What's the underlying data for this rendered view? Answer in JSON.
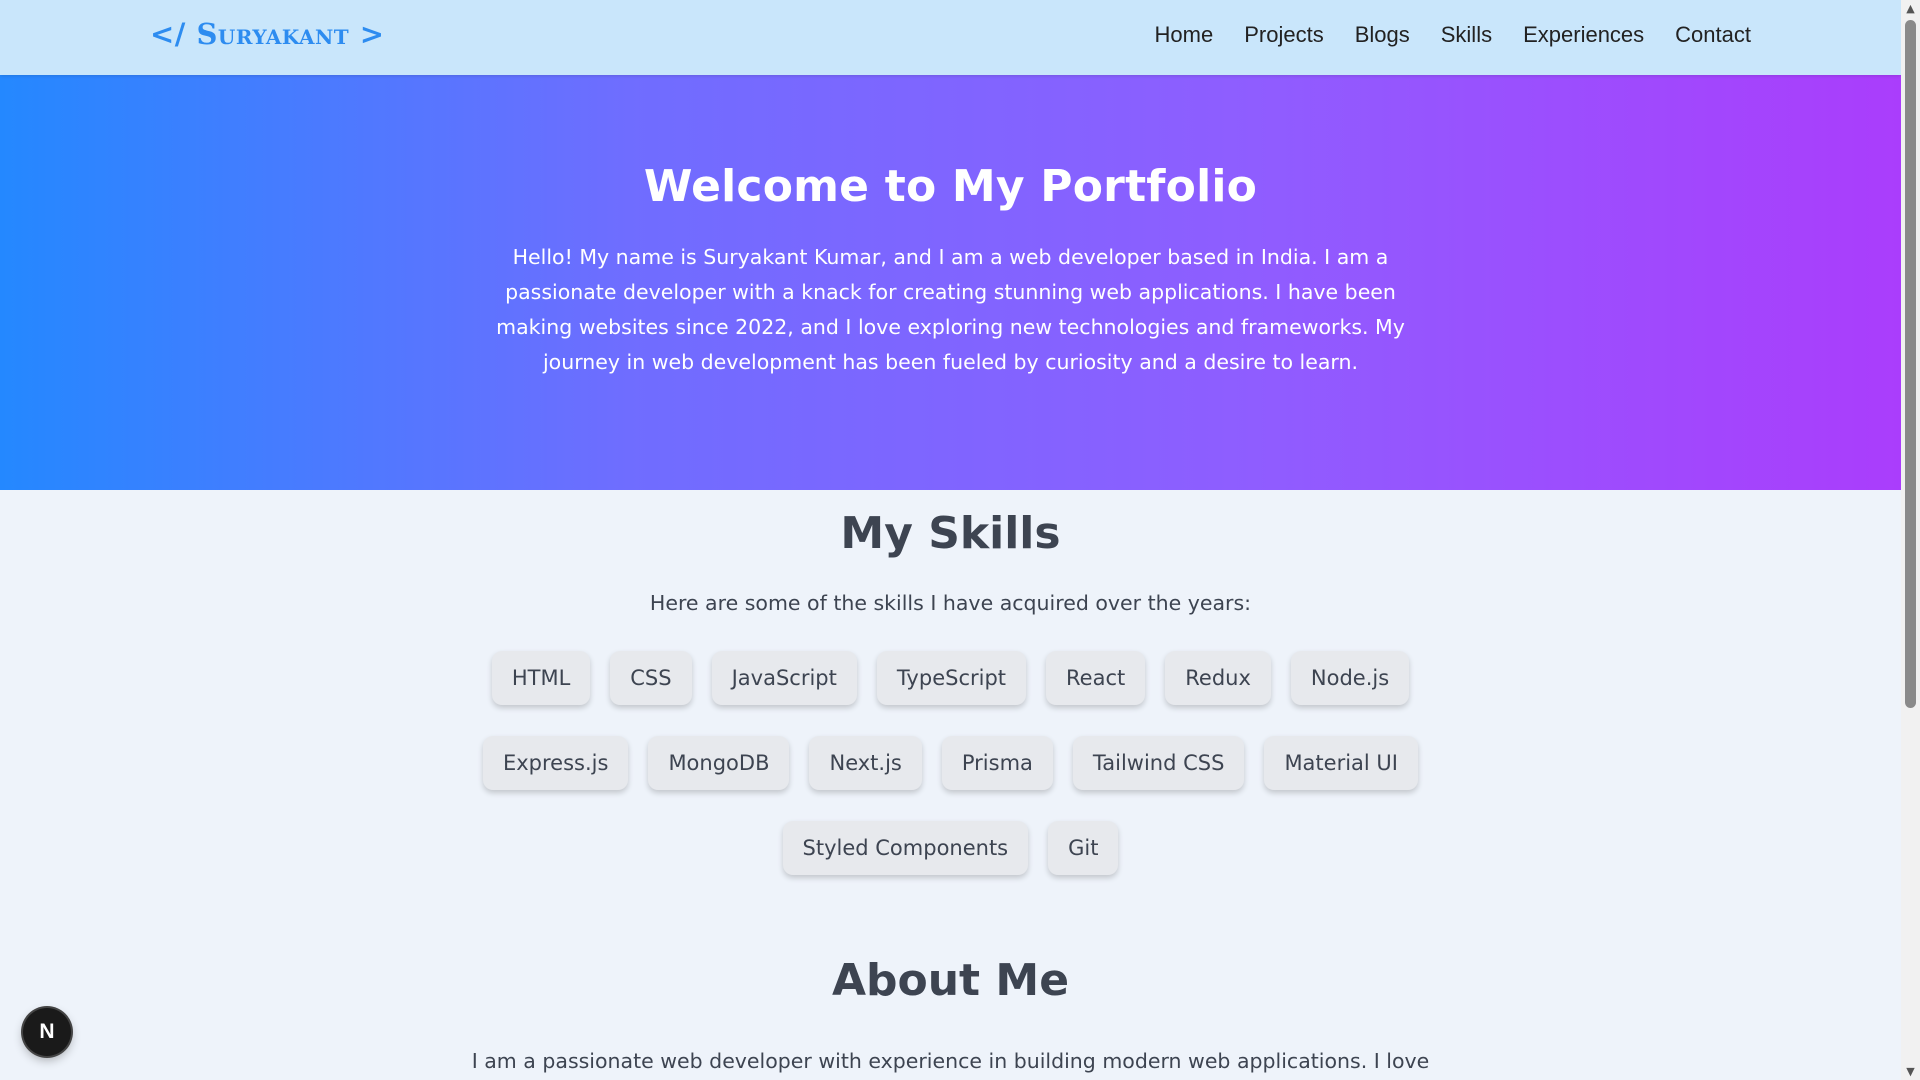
{
  "header": {
    "logo": "</ Suryakant >",
    "nav": [
      "Home",
      "Projects",
      "Blogs",
      "Skills",
      "Experiences",
      "Contact"
    ]
  },
  "hero": {
    "title": "Welcome to My Portfolio",
    "text": "Hello! My name is Suryakant Kumar, and I am a web developer based in India. I am a passionate developer with a knack for creating stunning web applications. I have been making websites since 2022, and I love exploring new technologies and frameworks. My journey in web development has been fueled by curiosity and a desire to learn."
  },
  "skills": {
    "title": "My Skills",
    "subtitle": "Here are some of the skills I have acquired over the years:",
    "items": [
      "HTML",
      "CSS",
      "JavaScript",
      "TypeScript",
      "React",
      "Redux",
      "Node.js",
      "Express.js",
      "MongoDB",
      "Next.js",
      "Prisma",
      "Tailwind CSS",
      "Material UI",
      "Styled Components",
      "Git"
    ]
  },
  "about": {
    "title": "About Me",
    "text": "I am a passionate web developer with experience in building modern web applications. I love"
  },
  "badge": {
    "label": "N"
  },
  "colors": {
    "header_bg": "#c9e6fb",
    "accent": "#2d8cf0",
    "gradient_start": "#2488ff",
    "gradient_end": "#aa3dfc",
    "chip_bg": "#e7e9ed"
  }
}
